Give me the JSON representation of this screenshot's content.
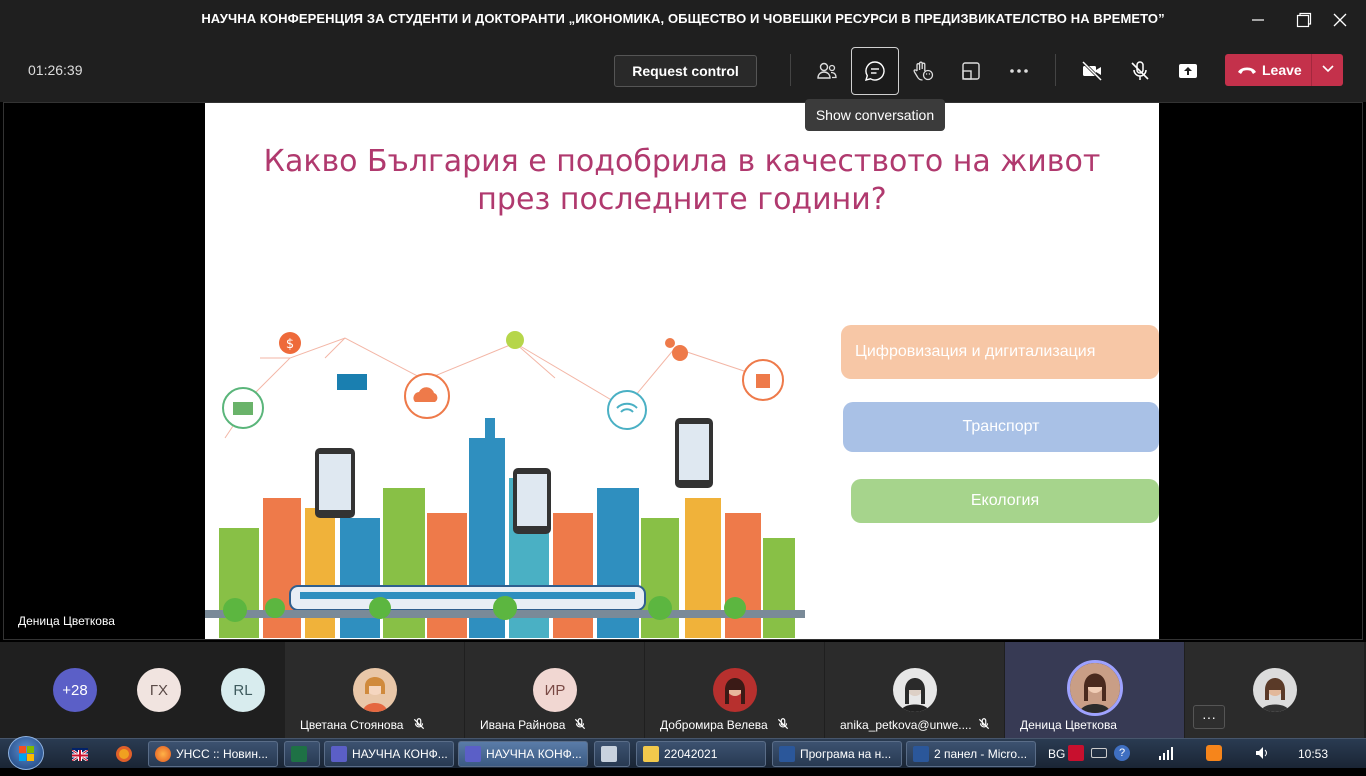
{
  "window": {
    "title": "НАУЧНА КОНФЕРЕНЦИЯ ЗА СТУДЕНТИ И ДОКТОРАНТИ „ИКОНОМИКА, ОБЩЕСТВО И ЧОВЕШКИ РЕСУРСИ В ПРЕДИЗВИКАТЕЛСТВО НА ВРЕМЕТО”"
  },
  "toolbar": {
    "timer": "01:26:39",
    "request_control_label": "Request control",
    "leave_label": "Leave",
    "tooltip": "Show conversation"
  },
  "slide": {
    "title_line1": "Какво България е подобрила в качеството на живот",
    "title_line2": "през последните години?",
    "items": [
      "Цифровизация и дигитализация",
      "Транспорт",
      "Екология"
    ]
  },
  "stage": {
    "speaker_name": "Деница Цветкова"
  },
  "participants": {
    "overflow_count": "+28",
    "initials": [
      {
        "text": "ГХ",
        "bg": "#f1e4e0",
        "fg": "#5a4a47"
      },
      {
        "text": "RL",
        "bg": "#d8ecee",
        "fg": "#3f5b5e"
      }
    ],
    "tiles": [
      {
        "name": "Цветана Стоянова",
        "initials": ""
      },
      {
        "name": "Ивана Райнова",
        "initials": "ИР"
      },
      {
        "name": "Добромира Велева",
        "initials": ""
      },
      {
        "name": "anika_petkova@unwe....",
        "initials": ""
      },
      {
        "name": "Деница Цветкова",
        "initials": ""
      },
      {
        "name": "",
        "initials": ""
      }
    ]
  },
  "taskbar": {
    "items": [
      "УНСС :: Новин...",
      "НАУЧНА КОНФ...",
      "НАУЧНА КОНФ...",
      "22042021",
      "Програма на н...",
      "2 панел - Micro..."
    ],
    "lang": "BG",
    "clock": "10:53"
  },
  "colors": {
    "accent_leave": "#c4314b",
    "slide_title": "#b0396e",
    "pill_digital": "#f7c7a6",
    "pill_transport": "#a9c1e6",
    "pill_ecology": "#a6d48c"
  }
}
